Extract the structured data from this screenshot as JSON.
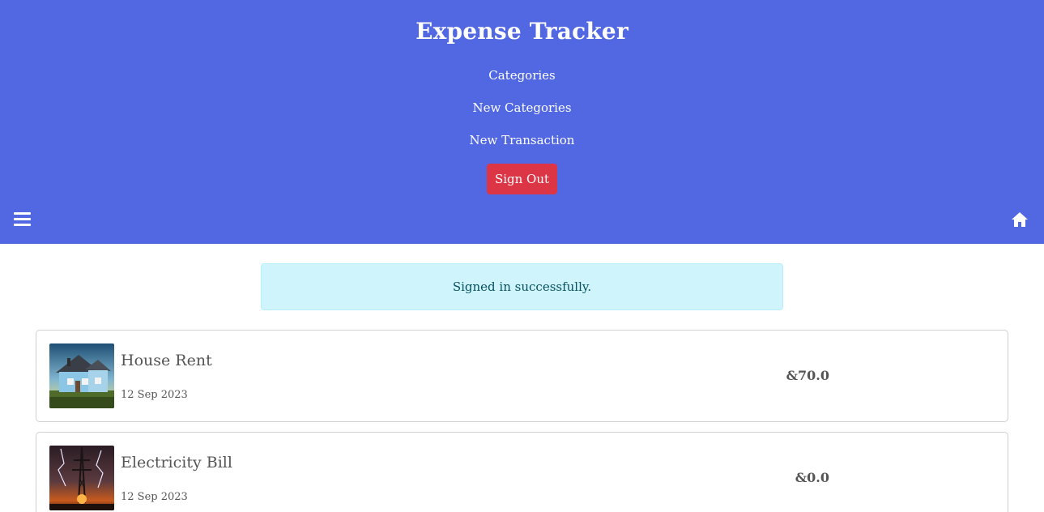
{
  "header": {
    "title": "Expense Tracker",
    "nav": [
      "Categories",
      "New Categories",
      "New Transaction"
    ],
    "signout_label": "Sign Out",
    "menu_icon": "hamburger-menu-icon",
    "home_icon": "home-icon",
    "bg_color": "#5267e2",
    "signout_color": "#dc3545"
  },
  "alert": {
    "message": "Signed in successfully.",
    "bg_color": "#cff4fc"
  },
  "transactions": [
    {
      "name": "House Rent",
      "date": "12 Sep 2023",
      "amount": "&70.0",
      "image": "house-image"
    },
    {
      "name": "Electricity Bill",
      "date": "12 Sep 2023",
      "amount": "&0.0",
      "image": "electricity-tower-image"
    }
  ]
}
